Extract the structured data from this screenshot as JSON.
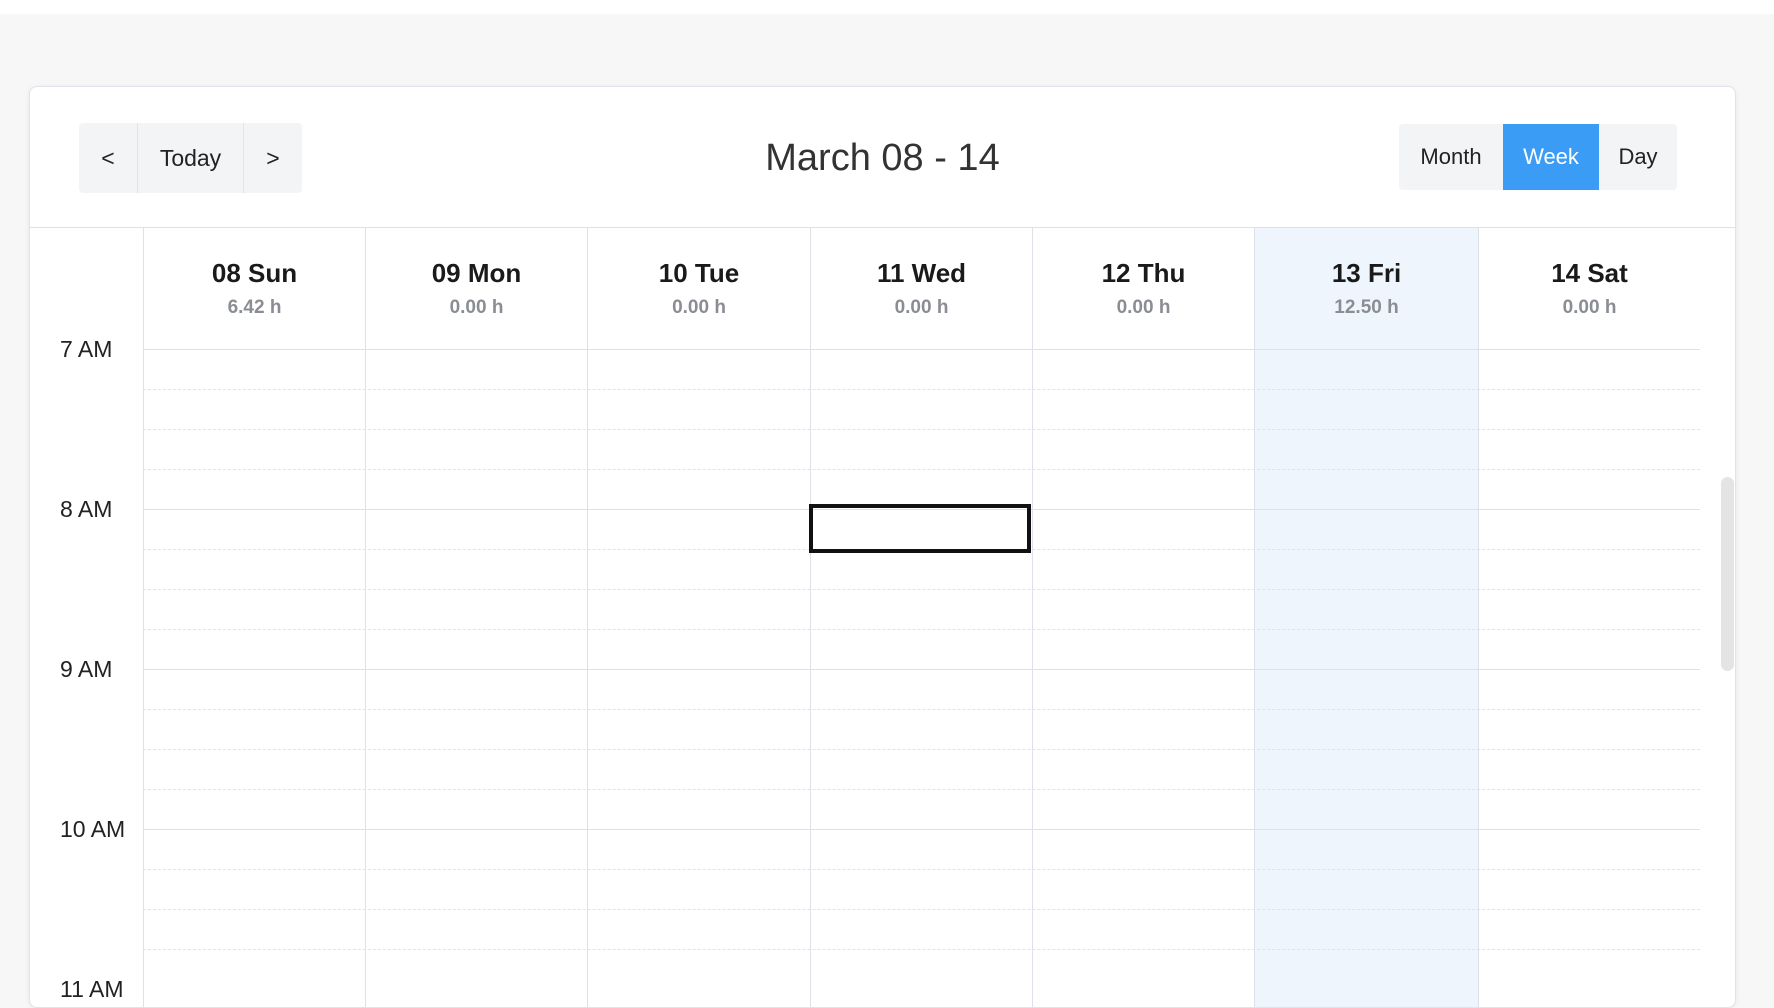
{
  "toolbar": {
    "prev_label": "<",
    "today_label": "Today",
    "next_label": ">",
    "title": "March 08 - 14",
    "views": [
      {
        "label": "Month",
        "active": false
      },
      {
        "label": "Week",
        "active": true
      },
      {
        "label": "Day",
        "active": false
      }
    ]
  },
  "days": [
    {
      "label": "08 Sun",
      "hours": "6.42 h",
      "today": false
    },
    {
      "label": "09 Mon",
      "hours": "0.00 h",
      "today": false
    },
    {
      "label": "10 Tue",
      "hours": "0.00 h",
      "today": false
    },
    {
      "label": "11 Wed",
      "hours": "0.00 h",
      "today": false
    },
    {
      "label": "12 Thu",
      "hours": "0.00 h",
      "today": false
    },
    {
      "label": "13 Fri",
      "hours": "12.50 h",
      "today": true
    },
    {
      "label": "14 Sat",
      "hours": "0.00 h",
      "today": false
    }
  ],
  "time_labels": [
    "7 AM",
    "8 AM",
    "9 AM",
    "10 AM",
    "11 AM"
  ],
  "colors": {
    "accent": "#3b9cf5",
    "today_column": "#eef5fd",
    "grid_line": "#dde1e8"
  }
}
